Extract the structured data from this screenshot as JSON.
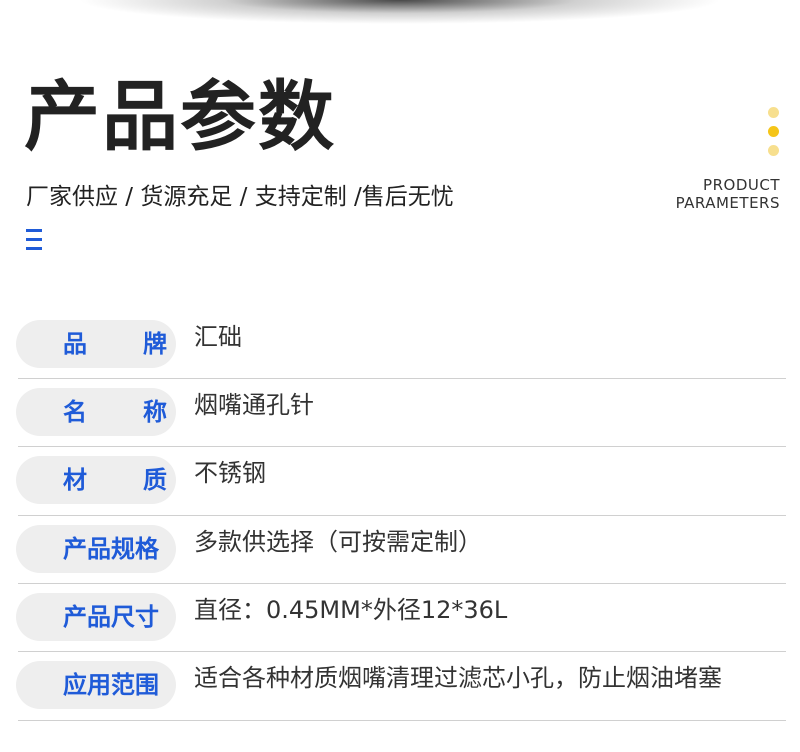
{
  "header": {
    "title": "产品参数",
    "subtitle": "厂家供应 / 货源充足 / 支持定制 /售后无忧",
    "product_en_line1": "PRODUCT",
    "product_en_line2": "PARAMETERS"
  },
  "colors": {
    "accent_blue": "#1f5bd8",
    "dot_yellow_light": "#f7df8e",
    "dot_yellow": "#f5c518",
    "pill_bg": "#eeeeee",
    "divider": "#d0d0d0"
  },
  "params": [
    {
      "label_chars": [
        "品",
        "牌"
      ],
      "value": "汇础"
    },
    {
      "label_chars": [
        "名",
        "称"
      ],
      "value": "烟嘴通孔针"
    },
    {
      "label_chars": [
        "材",
        "质"
      ],
      "value": "不锈钢"
    },
    {
      "label": "产品规格",
      "value": "多款供选择（可按需定制）"
    },
    {
      "label": "产品尺寸",
      "value": "直径：0.45MM*外径12*36L"
    },
    {
      "label": "应用范围",
      "value": "适合各种材质烟嘴清理过滤芯小孔，防止烟油堵塞"
    }
  ]
}
